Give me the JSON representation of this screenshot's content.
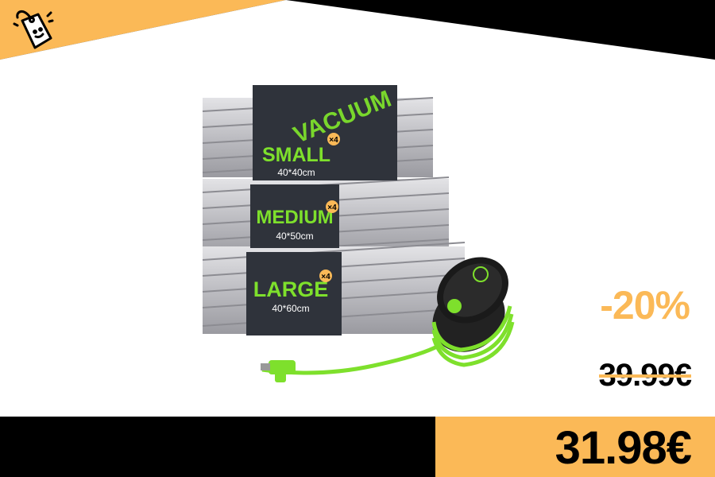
{
  "banner": {
    "discount": "-20%",
    "old_price": "39.99€",
    "new_price": "31.98€"
  },
  "product": {
    "wrap_text": "VACUUM",
    "sizes": [
      {
        "name": "SMALL",
        "dims": "40*40cm",
        "qty": "×4"
      },
      {
        "name": "MEDIUM",
        "dims": "40*50cm",
        "qty": "×4"
      },
      {
        "name": "LARGE",
        "dims": "40*60cm",
        "qty": "×4"
      }
    ]
  },
  "colors": {
    "accent_orange": "#fbb957",
    "accent_green": "#7ee02c",
    "box_dark": "#2f333b"
  }
}
